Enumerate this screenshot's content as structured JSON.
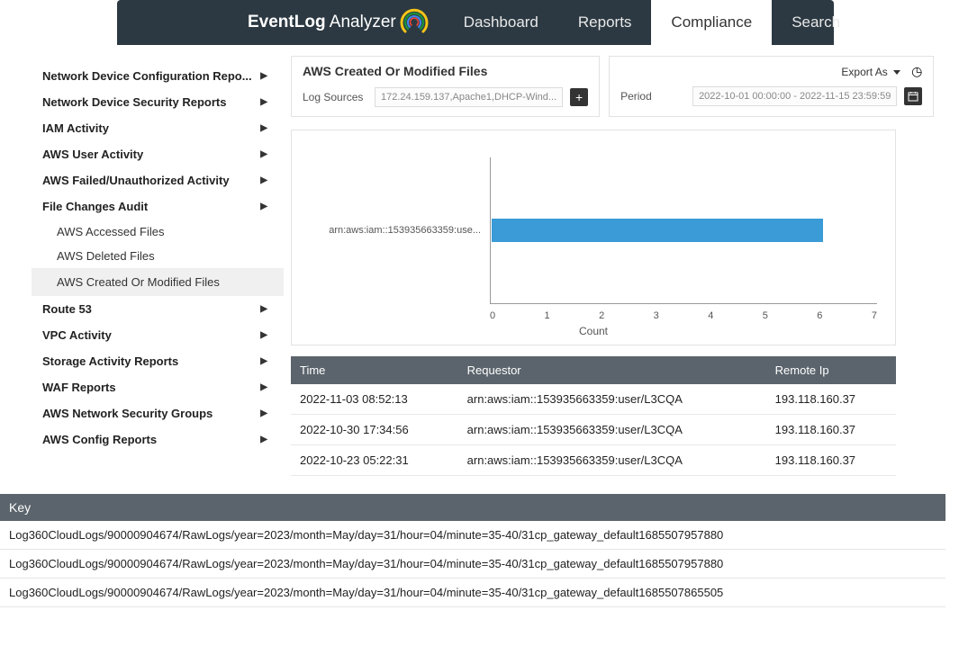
{
  "app": {
    "logo_prefix": "EventLog",
    "logo_suffix": " Analyzer"
  },
  "nav": {
    "tabs": [
      "Dashboard",
      "Reports",
      "Compliance",
      "Search"
    ],
    "active": 2
  },
  "sidebar": {
    "items": [
      {
        "label": "Network Device Configuration Repo...",
        "bold": true,
        "expandable": true
      },
      {
        "label": "Network Device Security Reports",
        "bold": true,
        "expandable": true
      },
      {
        "label": "IAM Activity",
        "bold": true,
        "expandable": true
      },
      {
        "label": "AWS User Activity",
        "bold": true,
        "expandable": true
      },
      {
        "label": "AWS Failed/Unauthorized Activity",
        "bold": true,
        "expandable": true
      },
      {
        "label": "File Changes Audit",
        "bold": true,
        "expandable": true,
        "expanded": true,
        "children": [
          {
            "label": "AWS Accessed Files"
          },
          {
            "label": "AWS Deleted Files"
          },
          {
            "label": "AWS Created Or Modified Files",
            "active": true
          }
        ]
      },
      {
        "label": "Route 53",
        "bold": true,
        "expandable": true
      },
      {
        "label": "VPC Activity",
        "bold": true,
        "expandable": true
      },
      {
        "label": "Storage Activity Reports",
        "bold": true,
        "expandable": true
      },
      {
        "label": "WAF Reports",
        "bold": true,
        "expandable": true
      },
      {
        "label": "AWS Network Security Groups",
        "bold": true,
        "expandable": true
      },
      {
        "label": "AWS Config Reports",
        "bold": true,
        "expandable": true
      }
    ]
  },
  "report": {
    "title": "AWS Created Or Modified Files",
    "log_sources_label": "Log Sources",
    "log_sources_value": "172.24.159.137,Apache1,DHCP-Wind...",
    "period_label": "Period",
    "period_value": "2022-10-01 00:00:00 - 2022-11-15 23:59:59",
    "export_label": "Export As"
  },
  "chart_data": {
    "type": "bar",
    "orientation": "horizontal",
    "categories": [
      "arn:aws:iam::153935663359:use..."
    ],
    "values": [
      6
    ],
    "xlabel": "Count",
    "xlim": [
      0,
      7
    ],
    "xticks": [
      0,
      1,
      2,
      3,
      4,
      5,
      6,
      7
    ]
  },
  "table": {
    "headers": [
      "Time",
      "Requestor",
      "Remote Ip"
    ],
    "rows": [
      [
        "2022-11-03 08:52:13",
        "arn:aws:iam::153935663359:user/L3CQA",
        "193.118.160.37"
      ],
      [
        "2022-10-30 17:34:56",
        "arn:aws:iam::153935663359:user/L3CQA",
        "193.118.160.37"
      ],
      [
        "2022-10-23 05:22:31",
        "arn:aws:iam::153935663359:user/L3CQA",
        "193.118.160.37"
      ]
    ]
  },
  "key_section": {
    "header": "Key",
    "rows": [
      "Log360CloudLogs/90000904674/RawLogs/year=2023/month=May/day=31/hour=04/minute=35-40/31cp_gateway_default1685507957880",
      "Log360CloudLogs/90000904674/RawLogs/year=2023/month=May/day=31/hour=04/minute=35-40/31cp_gateway_default1685507957880",
      "Log360CloudLogs/90000904674/RawLogs/year=2023/month=May/day=31/hour=04/minute=35-40/31cp_gateway_default1685507865505"
    ]
  }
}
